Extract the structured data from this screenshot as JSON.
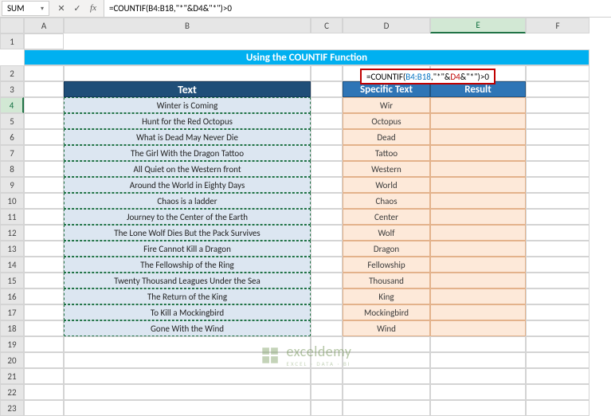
{
  "name_box": "SUM",
  "fb_icons": {
    "cancel": "✕",
    "enter": "✓",
    "fx": "fx"
  },
  "formula_bar": "=COUNTIF(B4:B18,\"*\"&D4&\"*\")>0",
  "title_band": "Using the COUNTIF Function",
  "headers": {
    "text": "Text",
    "specific": "Specific Text",
    "result": "Result"
  },
  "text_col": [
    "Winter is Coming",
    "Hunt for the Red Octopus",
    "What is Dead May Never Die",
    "The Girl With the Dragon Tattoo",
    "All Quiet on the Western front",
    "Around the World in Eighty Days",
    "Chaos is a ladder",
    "Journey to the Center of the Earth",
    "The Lone Wolf Dies But the Pack Survives",
    "Fire Cannot Kill a Dragon",
    "The Fellowship of the Ring",
    "Twenty Thousand Leagues Under the Sea",
    "The Return of the King",
    "To Kill a Mockingbird",
    "Gone With the Wind"
  ],
  "spec_col": [
    "Win",
    "Octopus",
    "Dead",
    "Tattoo",
    "Western",
    "World",
    "Chaos",
    "Center",
    "Wolf",
    "Dragon",
    "Fellowship",
    "Thousand",
    "King",
    "Mockingbird",
    "Wind"
  ],
  "spec_col_visible_first": "Wir",
  "inline_formula_parts": {
    "p1": "=COUNTIF(",
    "p2": "B4:B18",
    "p3": ",\"*\"&",
    "p4": "D4",
    "p5": "&\"*\")>0"
  },
  "col_labels": [
    "A",
    "B",
    "C",
    "D",
    "E",
    "F"
  ],
  "row_count": 23,
  "watermark": {
    "brand": "exceldemy",
    "tag": "EXCEL · DATA · BI"
  },
  "chart_data": {
    "type": "table",
    "title": "Using the COUNTIF Function",
    "columns": [
      "Text",
      "Specific Text",
      "Result"
    ],
    "rows": [
      [
        "Winter is Coming",
        "Win",
        "=COUNTIF(B4:B18,\"*\"&D4&\"*\")>0"
      ],
      [
        "Hunt for the Red Octopus",
        "Octopus",
        ""
      ],
      [
        "What is Dead May Never Die",
        "Dead",
        ""
      ],
      [
        "The Girl With the Dragon Tattoo",
        "Tattoo",
        ""
      ],
      [
        "All Quiet on the Western front",
        "Western",
        ""
      ],
      [
        "Around the World in Eighty Days",
        "World",
        ""
      ],
      [
        "Chaos is a ladder",
        "Chaos",
        ""
      ],
      [
        "Journey to the Center of the Earth",
        "Center",
        ""
      ],
      [
        "The Lone Wolf Dies But the Pack Survives",
        "Wolf",
        ""
      ],
      [
        "Fire Cannot Kill a Dragon",
        "Dragon",
        ""
      ],
      [
        "The Fellowship of the Ring",
        "Fellowship",
        ""
      ],
      [
        "Twenty Thousand Leagues Under the Sea",
        "Thousand",
        ""
      ],
      [
        "The Return of the King",
        "King",
        ""
      ],
      [
        "To Kill a Mockingbird",
        "Mockingbird",
        ""
      ],
      [
        "Gone With the Wind",
        "Wind",
        ""
      ]
    ]
  }
}
